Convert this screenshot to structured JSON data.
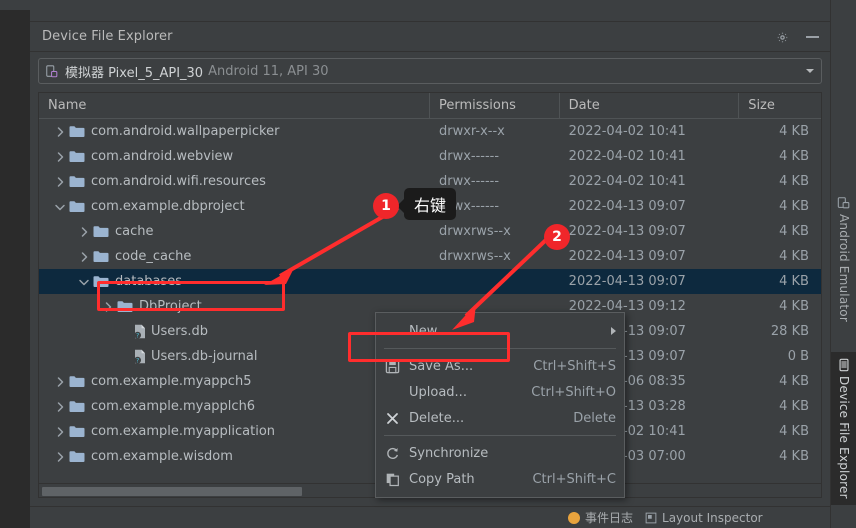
{
  "panel": {
    "title": "Device File Explorer",
    "settings_icon": "gear-icon",
    "minimize_icon": "minimize-icon"
  },
  "device_selector": {
    "icon": "device-icon",
    "name": "模拟器 Pixel_5_API_30",
    "detail": "Android 11, API 30",
    "dropdown_icon": "chevron-down-icon"
  },
  "table": {
    "columns": [
      "Name",
      "Permissions",
      "Date",
      "Size"
    ],
    "rows": [
      {
        "name": "com.android.wallpaperpicker",
        "indent": 1,
        "type": "folder",
        "twisty": "right",
        "perm": "drwxr-x--x",
        "date": "2022-04-02 10:41",
        "size": "4 KB",
        "selected": false
      },
      {
        "name": "com.android.webview",
        "indent": 1,
        "type": "folder",
        "twisty": "right",
        "perm": "drwx------",
        "date": "2022-04-02 10:41",
        "size": "4 KB",
        "selected": false
      },
      {
        "name": "com.android.wifi.resources",
        "indent": 1,
        "type": "folder",
        "twisty": "right",
        "perm": "drwx------",
        "date": "2022-04-02 10:41",
        "size": "4 KB",
        "selected": false
      },
      {
        "name": "com.example.dbproject",
        "indent": 1,
        "type": "folder",
        "twisty": "down",
        "perm": "drwx------",
        "date": "2022-04-13 09:07",
        "size": "4 KB",
        "selected": false
      },
      {
        "name": "cache",
        "indent": 2,
        "type": "folder",
        "twisty": "right",
        "perm": "drwxrws--x",
        "date": "2022-04-13 09:07",
        "size": "4 KB",
        "selected": false
      },
      {
        "name": "code_cache",
        "indent": 2,
        "type": "folder",
        "twisty": "right",
        "perm": "drwxrws--x",
        "date": "2022-04-13 09:07",
        "size": "4 KB",
        "selected": false
      },
      {
        "name": "databases",
        "indent": 2,
        "type": "folder",
        "twisty": "down",
        "perm": "",
        "date": "2022-04-13 09:07",
        "size": "4 KB",
        "selected": true
      },
      {
        "name": "DbProject",
        "indent": 3,
        "type": "folder",
        "twisty": "right",
        "perm": "",
        "date": "2022-04-13 09:12",
        "size": "4 KB",
        "selected": false
      },
      {
        "name": "Users.db",
        "indent": 3,
        "type": "file",
        "twisty": "none",
        "perm": "",
        "date": "2022-04-13 09:07",
        "size": "28 KB",
        "selected": false
      },
      {
        "name": "Users.db-journal",
        "indent": 3,
        "type": "file",
        "twisty": "none",
        "perm": "",
        "date": "2022-04-13 09:07",
        "size": "0 B",
        "selected": false
      },
      {
        "name": "com.example.myappch5",
        "indent": 1,
        "type": "folder",
        "twisty": "right",
        "perm": "",
        "date": "2022-04-06 08:35",
        "size": "4 KB",
        "selected": false
      },
      {
        "name": "com.example.myapplch6",
        "indent": 1,
        "type": "folder",
        "twisty": "right",
        "perm": "",
        "date": "2022-04-13 03:28",
        "size": "4 KB",
        "selected": false
      },
      {
        "name": "com.example.myapplication",
        "indent": 1,
        "type": "folder",
        "twisty": "right",
        "perm": "",
        "date": "2022-04-02 10:41",
        "size": "4 KB",
        "selected": false
      },
      {
        "name": "com.example.wisdom",
        "indent": 1,
        "type": "folder",
        "twisty": "right",
        "perm": "",
        "date": "2022-04-03 07:00",
        "size": "4 KB",
        "selected": false
      }
    ]
  },
  "context_menu": {
    "items": [
      {
        "label": "New",
        "shortcut": "",
        "icon": "none",
        "submenu": true
      },
      {
        "label": "Save As...",
        "shortcut": "Ctrl+Shift+S",
        "icon": "save-icon",
        "submenu": false
      },
      {
        "label": "Upload...",
        "shortcut": "Ctrl+Shift+O",
        "icon": "none",
        "submenu": false
      },
      {
        "label": "Delete...",
        "shortcut": "Delete",
        "icon": "close-icon",
        "submenu": false
      },
      {
        "label": "Synchronize",
        "shortcut": "",
        "icon": "refresh-icon",
        "submenu": false
      },
      {
        "label": "Copy Path",
        "shortcut": "Ctrl+Shift+C",
        "icon": "copy-icon",
        "submenu": false
      }
    ]
  },
  "annotations": {
    "badge1": "1",
    "badge2": "2",
    "tooltip": "右键",
    "highlight_color": "#ff2d2d"
  },
  "right_tool_tabs": [
    {
      "label": "Android Emulator",
      "icon": "emulator-icon",
      "active": false
    },
    {
      "label": "Device File Explorer",
      "icon": "phone-icon",
      "active": true
    }
  ],
  "status_bar": {
    "event_log": "事件日志",
    "layout_inspector": "Layout Inspector"
  }
}
